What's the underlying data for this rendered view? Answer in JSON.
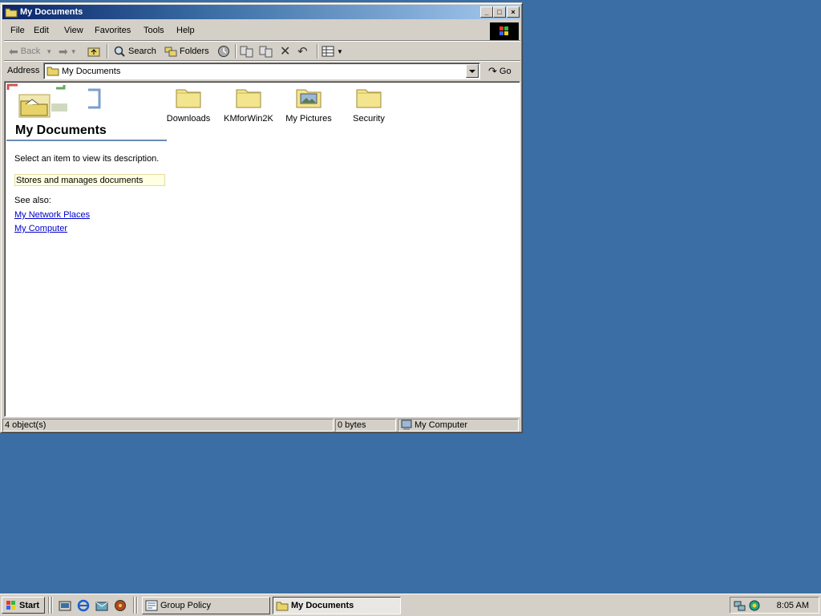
{
  "window": {
    "title": "My Documents",
    "menu": [
      "File",
      "Edit",
      "View",
      "Favorites",
      "Tools",
      "Help"
    ],
    "toolbar": {
      "back": "Back",
      "search": "Search",
      "folders": "Folders"
    },
    "address": {
      "label": "Address",
      "value": "My Documents",
      "go": "Go"
    },
    "panel": {
      "title": "My Documents",
      "description": "Select an item to view its description.",
      "info": "Stores and manages documents",
      "see_also": "See also:",
      "links": [
        "My Network Places",
        "My Computer"
      ]
    },
    "files": [
      {
        "name": "Downloads",
        "icon": "folder-icon"
      },
      {
        "name": "KMforWin2K",
        "icon": "folder-icon"
      },
      {
        "name": "My Pictures",
        "icon": "pictures-folder-icon"
      },
      {
        "name": "Security",
        "icon": "folder-icon"
      }
    ],
    "status": {
      "objects": "4 object(s)",
      "size": "0 bytes",
      "zone": "My Computer"
    }
  },
  "taskbar": {
    "start": "Start",
    "tasks": [
      {
        "label": "Group Policy",
        "active": false
      },
      {
        "label": "My Documents",
        "active": true
      }
    ],
    "clock": "8:05 AM"
  },
  "colors": {
    "desktop": "#3a6ea5",
    "title_active_start": "#0a246a",
    "title_active_end": "#a6caf0",
    "link": "#0000cc",
    "info_bg": "#ffffe1"
  }
}
